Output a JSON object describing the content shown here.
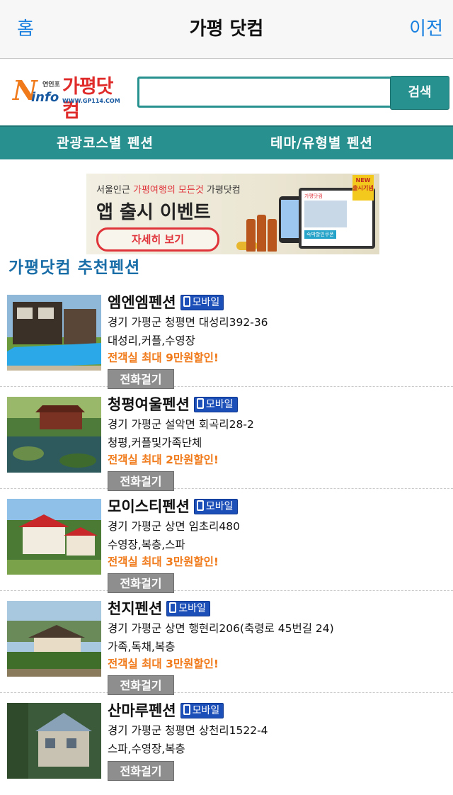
{
  "navbar": {
    "home_label": "홈",
    "title": "가평 닷컴",
    "back_label": "이전"
  },
  "logo": {
    "small_text": "연인포",
    "info_text": "info",
    "brand_text": "가평닷컴",
    "url_text": "WWW.GP114.COM"
  },
  "search": {
    "value": "",
    "button_label": "검색"
  },
  "tabs": [
    {
      "label": "관광코스별 펜션"
    },
    {
      "label": "테마/유형별 펜션"
    }
  ],
  "banner": {
    "line1_prefix": "서울인근 ",
    "line1_highlight": "가평여행의 모든것",
    "line1_suffix": " 가평닷컴",
    "line2": "앱 출시 이벤트",
    "button_label": "자세히 보기",
    "badge_text": "NEW 출시기념",
    "tablet_header": "가평닷컴",
    "tablet_coupon": "숙박할인쿠폰"
  },
  "section_title": "가평닷컴 추천펜션",
  "mobile_badge_label": "모바일",
  "call_button_label": "전화걸기",
  "listings": [
    {
      "name": "엠엔엠펜션",
      "address": "경기 가평군 청평면 대성리392-36",
      "tags": "대성리,커플,수영장",
      "promo": "전객실 최대 9만원할인!"
    },
    {
      "name": "청평여울펜션",
      "address": "경기 가평군 설악면 회곡리28-2",
      "tags": "청평,커플및가족단체",
      "promo": "전객실 최대 2만원할인!"
    },
    {
      "name": "모이스티펜션",
      "address": "경기 가평군 상면 임초리480",
      "tags": "수영장,복층,스파",
      "promo": "전객실 최대 3만원할인!"
    },
    {
      "name": "천지펜션",
      "address": "경기 가평군 상면 행현리206(축령로 45번길 24)",
      "tags": "가족,독채,복층",
      "promo": "전객실 최대 3만원할인!"
    },
    {
      "name": "산마루펜션",
      "address": "경기 가평군 청평면 상천리1522-4",
      "tags": "스파,수영장,복층",
      "promo": ""
    }
  ],
  "colors": {
    "accent": "#28908e",
    "link": "#1a80e0",
    "promo": "#f07a1a",
    "badge": "#1d4fb8"
  }
}
